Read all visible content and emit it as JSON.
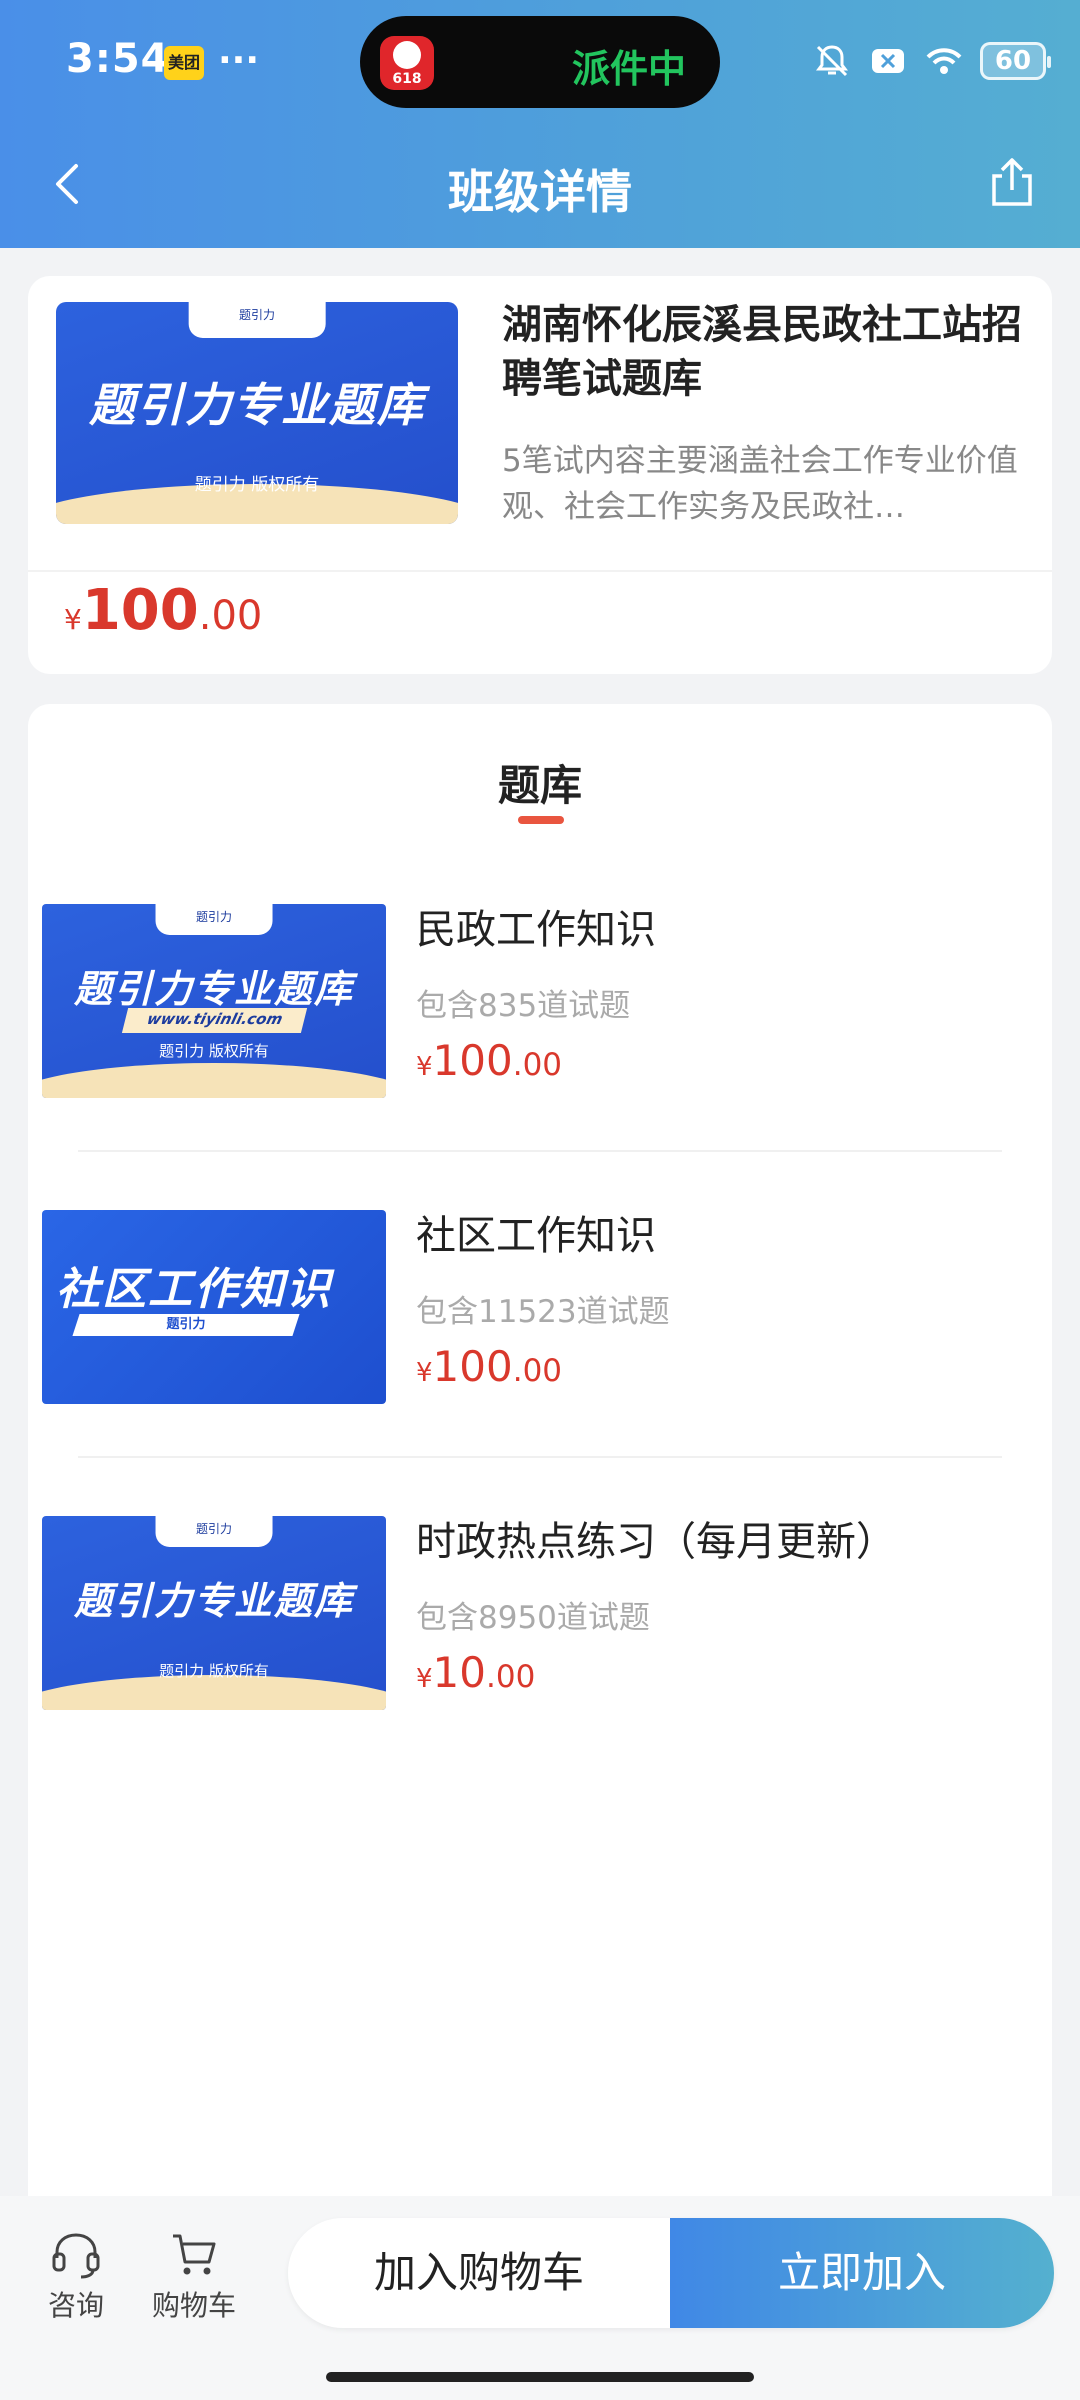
{
  "status_bar": {
    "time": "3:54",
    "meituan_badge": "美团",
    "more_dots": "···",
    "island_app_label": "618",
    "island_text": "派件中",
    "battery": "60"
  },
  "nav": {
    "title": "班级详情"
  },
  "product": {
    "thumb_tag": "题引力",
    "thumb_title": "题引力专业题库",
    "thumb_sub": "题引力 版权所有",
    "name": "湖南怀化辰溪县民政社工站招聘笔试题库",
    "description": "5笔试内容主要涵盖社会工作专业价值观、社会工作实务及民政社…",
    "price": {
      "currency": "¥",
      "integer": "100",
      "decimal": ".00"
    }
  },
  "bank": {
    "heading": "题库",
    "items": [
      {
        "thumb_tag": "题引力",
        "thumb_title": "题引力专业题库",
        "thumb_url": "www.tiyinli.com",
        "thumb_sub": "题引力 版权所有",
        "name": "民政工作知识",
        "count": "包含835道试题",
        "price": {
          "currency": "¥",
          "integer": "100",
          "decimal": ".00"
        }
      },
      {
        "thumb_title": "社区工作知识",
        "thumb_sub": "题引力",
        "name": "社区工作知识",
        "count": "包含11523道试题",
        "price": {
          "currency": "¥",
          "integer": "100",
          "decimal": ".00"
        }
      },
      {
        "thumb_tag": "题引力",
        "thumb_title": "题引力专业题库",
        "thumb_sub": "题引力 版权所有",
        "name": "时政热点练习（每月更新）",
        "count": "包含8950道试题",
        "price": {
          "currency": "¥",
          "integer": "10",
          "decimal": ".00"
        }
      }
    ]
  },
  "bottom_bar": {
    "consult_label": "咨询",
    "cart_label": "购物车",
    "add_to_cart": "加入购物车",
    "join_now": "立即加入"
  },
  "colors": {
    "header_start": "#4a8fe8",
    "header_end": "#55aed2",
    "price_red": "#d9382c",
    "tab_underline": "#e9553f"
  }
}
